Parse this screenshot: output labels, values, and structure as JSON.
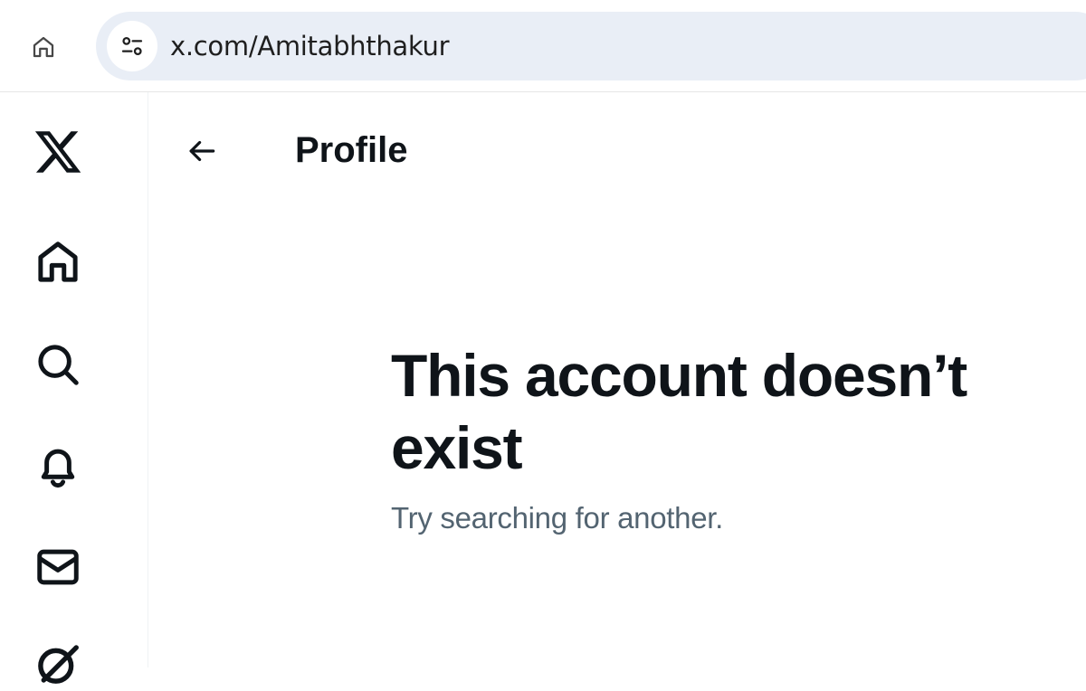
{
  "browser": {
    "url": "x.com/Amitabhthakur",
    "home_icon": "home-outline-icon",
    "site_info_icon": "tune-icon"
  },
  "sidebar": {
    "items": [
      {
        "name": "x-logo",
        "icon": "x-logo-icon"
      },
      {
        "name": "home",
        "icon": "home-icon"
      },
      {
        "name": "explore",
        "icon": "search-icon"
      },
      {
        "name": "notifications",
        "icon": "bell-icon"
      },
      {
        "name": "messages",
        "icon": "envelope-icon"
      },
      {
        "name": "grok",
        "icon": "grok-icon"
      }
    ]
  },
  "header": {
    "title": "Profile",
    "back_icon": "arrow-left-icon"
  },
  "empty_state": {
    "heading": "This account doesn’t exist",
    "subtext": "Try searching for another."
  },
  "colors": {
    "text_primary": "#0f1419",
    "text_secondary": "#536471",
    "omnibox_bg": "#e9eef6"
  }
}
